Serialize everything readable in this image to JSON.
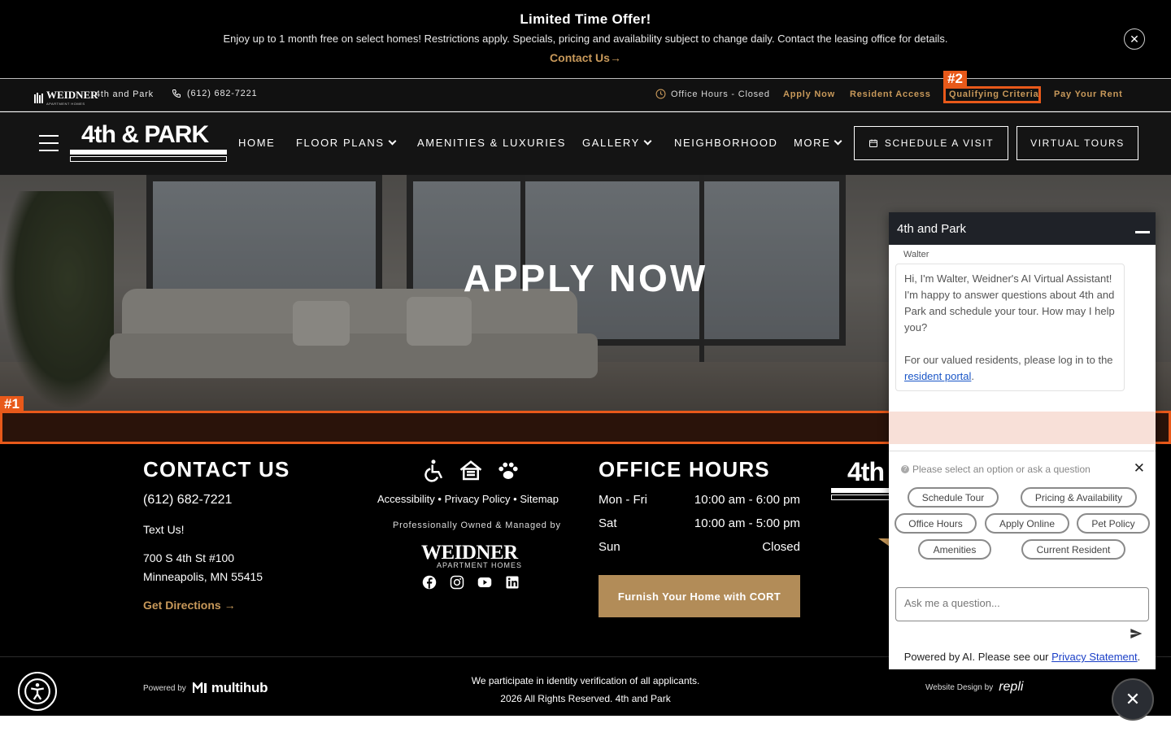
{
  "promo": {
    "title": "Limited Time Offer!",
    "text": "Enjoy up to 1 month free on select homes! Restrictions apply. Specials, pricing and availability subject to change daily. Contact the leasing office for details.",
    "link": "Contact Us",
    "close": "✕"
  },
  "utility": {
    "property_name": "4th and Park",
    "phone": "(612) 682-7221",
    "hours": "Office Hours - Closed",
    "links": [
      "Apply Now",
      "Resident Access",
      "Qualifying Criteria",
      "Pay Your Rent"
    ]
  },
  "markers": {
    "one": "#1",
    "two": "#2"
  },
  "nav": {
    "brand": "4th & PARK",
    "items": [
      "HOME",
      "FLOOR PLANS",
      "AMENITIES & LUXURIES",
      "GALLERY",
      "NEIGHBORHOOD",
      "MORE"
    ],
    "schedule": "SCHEDULE A VISIT",
    "tours": "VIRTUAL TOURS"
  },
  "hero": {
    "title": "APPLY NOW"
  },
  "contact": {
    "heading": "CONTACT US",
    "phone": "(612) 682-7221",
    "text_us": "Text Us!",
    "address1": "700 S 4th St #100",
    "address2": "Minneapolis, MN 55415",
    "directions": "Get Directions"
  },
  "center": {
    "accessibility": "Accessibility",
    "privacy": "Privacy Policy",
    "sitemap": "Sitemap",
    "managed": "Professionally Owned & Managed by",
    "weidner": "WEIDNER",
    "weidner_sub": "APARTMENT HOMES"
  },
  "hours": {
    "heading": "OFFICE HOURS",
    "rows": [
      {
        "day": "Mon - Fri",
        "time": "10:00 am - 6:00 pm"
      },
      {
        "day": "Sat",
        "time": "10:00 am - 5:00 pm"
      },
      {
        "day": "Sun",
        "time": "Closed"
      }
    ],
    "cort": "Furnish Your Home with CORT"
  },
  "footer_logo": "4th",
  "subfooter": {
    "powered": "Powered by",
    "multihub": "multihub",
    "legal1": "We participate in identity verification of all applicants.",
    "legal2": "2026 All Rights Reserved. 4th and Park",
    "design": "Website Design by",
    "repli": "repli"
  },
  "chat": {
    "title": "4th and Park",
    "sender": "Walter",
    "message1": "Hi, I'm Walter, Weidner's AI Virtual Assistant! I'm happy to answer questions about 4th and Park and schedule your tour. How may I help you?",
    "message2_pre": "For our valued residents, please log in to the",
    "message2_link": "resident portal",
    "prompt": "Please select an option or ask a question",
    "chips": [
      "Schedule Tour",
      "Pricing & Availability",
      "Office Hours",
      "Apply Online",
      "Pet Policy",
      "Amenities",
      "Current Resident"
    ],
    "input_placeholder": "Ask me a question...",
    "foot_pre": "Powered by AI. Please see our",
    "foot_link": "Privacy Statement"
  }
}
